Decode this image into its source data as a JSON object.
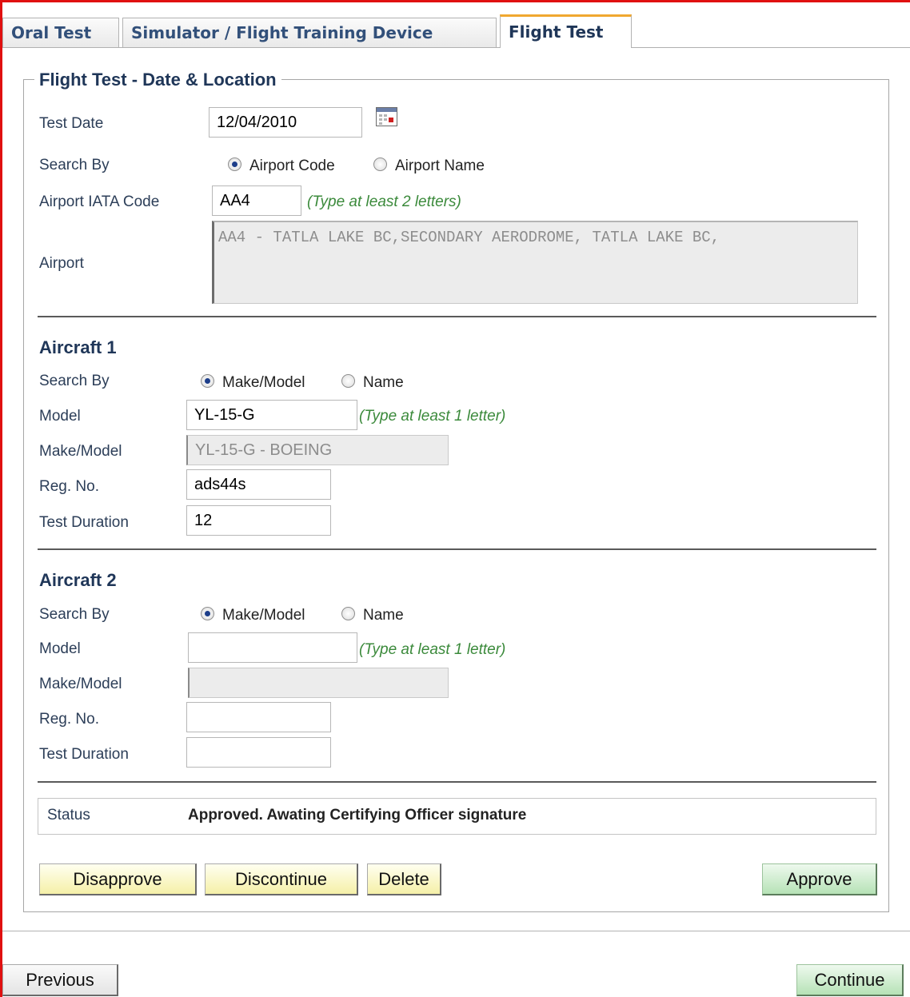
{
  "tabs": [
    {
      "label": "Oral Test",
      "active": false
    },
    {
      "label": "Simulator / Flight Training Device",
      "active": false
    },
    {
      "label": "Flight Test",
      "active": true
    }
  ],
  "location": {
    "legend": "Flight Test - Date & Location",
    "test_date_label": "Test Date",
    "test_date_value": "12/04/2010",
    "search_by_label": "Search By",
    "search_options": [
      "Airport Code",
      "Airport Name"
    ],
    "search_selected": "Airport Code",
    "iata_label": "Airport IATA Code",
    "iata_value": "AA4",
    "iata_hint": "(Type at least 2 letters)",
    "airport_label": "Airport",
    "airport_value": "AA4 - TATLA LAKE BC,SECONDARY AERODROME, TATLA LAKE BC,"
  },
  "aircraft1": {
    "title": "Aircraft 1",
    "search_by_label": "Search By",
    "search_options": [
      "Make/Model",
      "Name"
    ],
    "search_selected": "Make/Model",
    "model_label": "Model",
    "model_value": "YL-15-G",
    "model_hint": "(Type at least 1 letter)",
    "make_model_label": "Make/Model",
    "make_model_value": "YL-15-G - BOEING",
    "reg_label": "Reg. No.",
    "reg_value": "ads44s",
    "duration_label": "Test Duration",
    "duration_value": "12"
  },
  "aircraft2": {
    "title": "Aircraft 2",
    "search_by_label": "Search By",
    "search_options": [
      "Make/Model",
      "Name"
    ],
    "search_selected": "Make/Model",
    "model_label": "Model",
    "model_value": "",
    "model_hint": "(Type at least 1 letter)",
    "make_model_label": "Make/Model",
    "make_model_value": "",
    "reg_label": "Reg. No.",
    "reg_value": "",
    "duration_label": "Test Duration",
    "duration_value": ""
  },
  "status": {
    "label": "Status",
    "value": "Approved. Awating Certifying Officer signature"
  },
  "actions": {
    "disapprove": "Disapprove",
    "discontinue": "Discontinue",
    "delete": "Delete",
    "approve": "Approve"
  },
  "nav": {
    "previous": "Previous",
    "continue": "Continue"
  },
  "colors": {
    "frame_border": "#e01010",
    "heading": "#1f3658",
    "hint": "#3b8a3b",
    "active_tab_accent": "#f0a830",
    "yellow_button": "#f5f0a8",
    "green_button": "#b6e2b6"
  }
}
